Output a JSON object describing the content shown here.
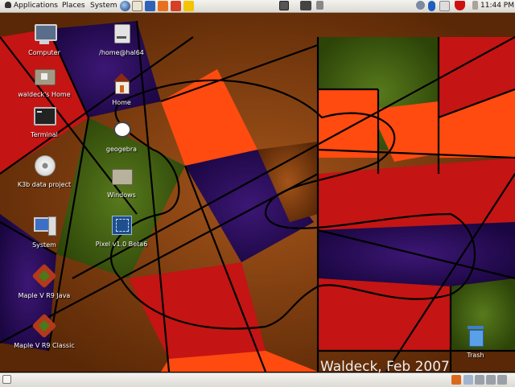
{
  "top_panel": {
    "menus": [
      "Applications",
      "Places",
      "System"
    ],
    "clock": "11:44 PM"
  },
  "desktop": {
    "icons": [
      {
        "label": "Computer",
        "icon": "computer-icon"
      },
      {
        "label": "/home@hal64",
        "icon": "network-drive-icon"
      },
      {
        "label": "waldeck's Home",
        "icon": "home-folder-icon"
      },
      {
        "label": "Home",
        "icon": "house-icon"
      },
      {
        "label": "Terminal",
        "icon": "terminal-icon"
      },
      {
        "label": "geogebra",
        "icon": "geogebra-icon"
      },
      {
        "label": "K3b data project",
        "icon": "cd-icon"
      },
      {
        "label": "Windows",
        "icon": "folder-icon"
      },
      {
        "label": "System",
        "icon": "system-icon"
      },
      {
        "label": "Pixel v1.0 Beta6",
        "icon": "pixel-app-icon"
      },
      {
        "label": "Maple V R9 Java",
        "icon": "maple-leaf-icon"
      },
      {
        "label": "Maple V R9 Classic",
        "icon": "maple-leaf-icon"
      },
      {
        "label": "Trash",
        "icon": "trash-icon"
      }
    ]
  },
  "wallpaper": {
    "signature": "Waldeck, Feb 2007"
  },
  "colors": {
    "panel": "#dcdad3",
    "wallpaper_brown": "#7a3a0c",
    "wallpaper_red": "#c41414",
    "wallpaper_orange": "#ff4a10",
    "wallpaper_purple": "#2a0a5a",
    "wallpaper_green": "#3d5a12"
  }
}
